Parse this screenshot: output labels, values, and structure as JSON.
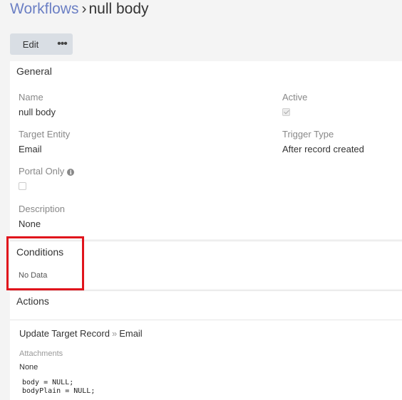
{
  "breadcrumb": {
    "parent": "Workflows",
    "separator": "›",
    "current": "null body"
  },
  "toolbar": {
    "edit_label": "Edit",
    "more_label": "•••"
  },
  "general": {
    "title": "General",
    "name_label": "Name",
    "name_value": "null body",
    "active_label": "Active",
    "active_checked": true,
    "target_entity_label": "Target Entity",
    "target_entity_value": "Email",
    "trigger_type_label": "Trigger Type",
    "trigger_type_value": "After record created",
    "portal_only_label": "Portal Only",
    "portal_only_checked": false,
    "info_icon_glyph": "i",
    "description_label": "Description",
    "description_value": "None"
  },
  "conditions": {
    "title": "Conditions",
    "empty_text": "No Data"
  },
  "actions": {
    "title": "Actions",
    "action_name": "Update Target Record",
    "action_separator": "»",
    "action_target": "Email",
    "attachments_label": "Attachments",
    "attachments_value": "None",
    "code_lines": [
      "body = NULL;",
      "bodyPlain = NULL;"
    ]
  },
  "colors": {
    "link": "#6b7fc4",
    "highlight": "#e0141c",
    "button_bg": "#d9dee4"
  }
}
